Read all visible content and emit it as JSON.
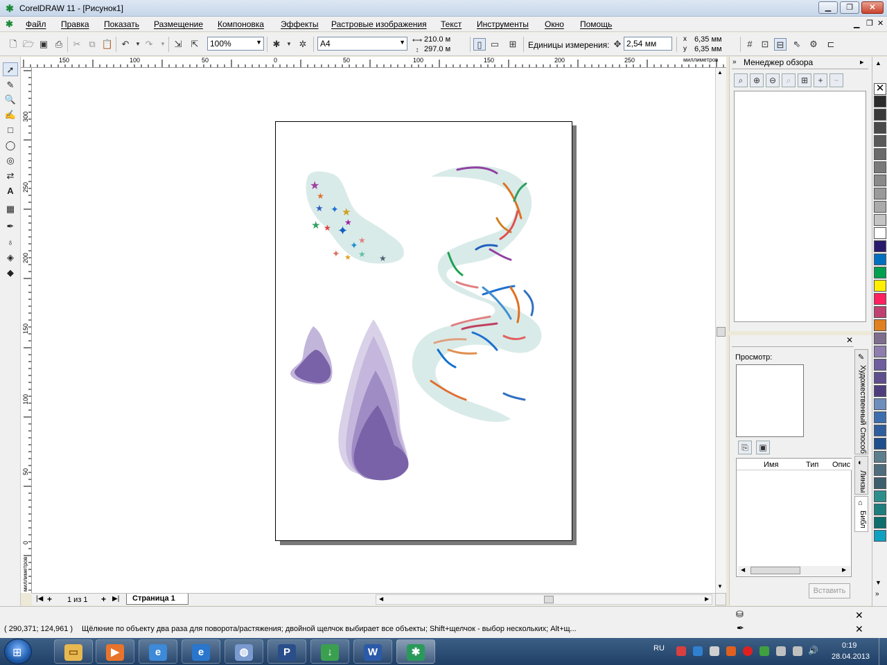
{
  "window": {
    "title": "CorelDRAW 11 - [Рисунок1]",
    "app_icon": "coreldraw-icon"
  },
  "menu": [
    "Файл",
    "Правка",
    "Показать",
    "Размещение",
    "Компоновка",
    "Эффекты",
    "Растровые изображения",
    "Текст",
    "Инструменты",
    "Окно",
    "Помощь"
  ],
  "toolbar": {
    "zoom": "100%",
    "paper_size": "A4",
    "width": "210.0 м",
    "height": "297.0 м",
    "units_label": "Единицы измерения:",
    "nudge": "2,54 мм",
    "dup_x": "6,35 мм",
    "dup_y": "6,35 мм",
    "x_label": "x",
    "y_label": "y"
  },
  "ruler": {
    "h_labels": [
      "150",
      "100",
      "50",
      "0",
      "50",
      "100",
      "150",
      "200",
      "250"
    ],
    "h_units": "миллиметров",
    "v_labels": [
      "300",
      "250",
      "200",
      "150",
      "100",
      "50",
      "0"
    ],
    "v_units": "миллиметров"
  },
  "page_nav": {
    "page_count": "1 из 1",
    "page_tab": "Страница 1"
  },
  "docker_view": {
    "title": "Менеджер обзора"
  },
  "docker_artistic": {
    "preview_label": "Просмотр:",
    "columns": [
      "Имя",
      "Тип",
      "Опис"
    ],
    "insert_button": "Вставить",
    "tabs": [
      "Художественный Способ",
      "Линзы",
      "Библ"
    ]
  },
  "status": {
    "coords": "( 290,371; 124,961 )",
    "hint": "Щёлкние по объекту два раза для поворота/растяжения; двойной щелчок выбирает все объекты; Shift+щелчок - выбор нескольких; Alt+щ..."
  },
  "taskbar": {
    "lang": "RU",
    "time": "0:19",
    "date": "28.04.2013"
  },
  "palette_colors": [
    "#ffffff",
    "#2b2b2b",
    "#3a3a3a",
    "#4a4a4a",
    "#5a5a5a",
    "#6a6a6a",
    "#7a7a7a",
    "#8a8a8a",
    "#9a9a9a",
    "#aaaaaa",
    "#c4c4c4",
    "#ffffff",
    "#2a1a6e",
    "#0070c0",
    "#00a050",
    "#ffee00",
    "#ff2060",
    "#c04070",
    "#e08020",
    "#7e6e8e",
    "#8e7eae",
    "#6e5e9e",
    "#5e4e8e",
    "#4e3e7e",
    "#6e8ebe",
    "#3e6eae",
    "#2e5e9e",
    "#1e4e8e",
    "#5e7e8e",
    "#4e6e7e",
    "#3e5e6e",
    "#2e8e8e",
    "#1e7e7e",
    "#0e6e6e",
    "#10a0c0"
  ]
}
